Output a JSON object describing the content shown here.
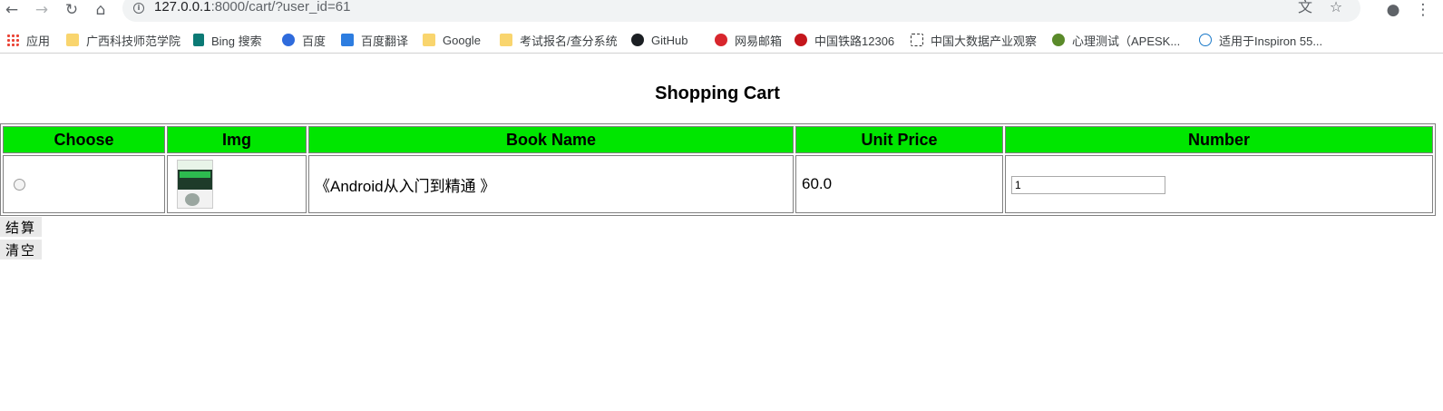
{
  "browser": {
    "url_host": "127.0.0.1",
    "url_rest": ":8000/cart/?user_id=61",
    "icons": {
      "back": "back-arrow-icon",
      "forward": "forward-arrow-icon",
      "reload": "reload-icon",
      "home": "home-icon",
      "translate": "translate-icon",
      "star": "bookmark-star-icon",
      "account": "account-icon",
      "menu": "kebab-menu-icon"
    }
  },
  "bookmarks": [
    {
      "label": "应用",
      "icon": "apps-grid-icon"
    },
    {
      "label": "广西科技师范学院",
      "icon": "folder-icon"
    },
    {
      "label": "Bing 搜索",
      "icon": "bing-icon"
    },
    {
      "label": "百度",
      "icon": "baidu-paw-icon"
    },
    {
      "label": "百度翻译",
      "icon": "baidu-translate-icon"
    },
    {
      "label": "Google",
      "icon": "folder-icon"
    },
    {
      "label": "考试报名/查分系统",
      "icon": "folder-icon"
    },
    {
      "label": "GitHub",
      "icon": "github-icon"
    },
    {
      "label": "网易邮箱",
      "icon": "netease-mail-icon"
    },
    {
      "label": "中国铁路12306",
      "icon": "railway-icon"
    },
    {
      "label": "中国大数据产业观察",
      "icon": "bigdata-icon"
    },
    {
      "label": "心理测试（APESK...",
      "icon": "apesk-icon"
    },
    {
      "label": "适用于Inspiron 55...",
      "icon": "dell-icon"
    }
  ],
  "page": {
    "title": "Shopping Cart",
    "columns": [
      "Choose",
      "Img",
      "Book Name",
      "Unit Price",
      "Number"
    ],
    "rows": [
      {
        "book_name": "《Android从入门到精通 》",
        "unit_price": "60.0",
        "number": "1"
      }
    ],
    "buttons": {
      "checkout": "结算",
      "clear": "清空"
    }
  },
  "colors": {
    "header_bg": "#00e600",
    "button_bg": "#e9e9e9"
  }
}
